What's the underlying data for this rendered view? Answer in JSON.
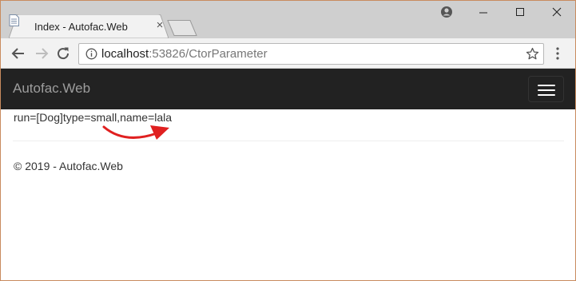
{
  "browser": {
    "tab": {
      "title": "Index - Autofac.Web",
      "favicon": "page-icon"
    },
    "address_bar": {
      "host": "localhost",
      "rest": ":53826/CtorParameter"
    },
    "icons": {
      "back": "arrow-left-icon",
      "forward": "arrow-right-icon",
      "reload": "reload-icon",
      "info": "info-icon",
      "bookmark": "star-icon",
      "menu": "vertical-dots-icon",
      "profile": "profile-icon"
    }
  },
  "navbar": {
    "brand": "Autofac.Web",
    "background": "#222222",
    "brand_color": "#9d9d9d"
  },
  "main": {
    "output_text": "run=[Dog]type=small,name=lala"
  },
  "annotation": {
    "arrow_color": "#e02020"
  },
  "footer": {
    "copyright": "© 2019 - Autofac.Web"
  }
}
